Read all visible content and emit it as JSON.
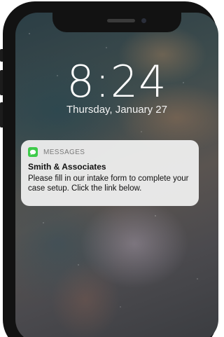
{
  "lock_screen": {
    "time": "8:24",
    "date": "Thursday, January 27"
  },
  "notification": {
    "app_name": "MESSAGES",
    "app_icon": "messages-icon",
    "title": "Smith & Associates",
    "body": "Please fill in our intake form to complete your case setup. Click the link below."
  },
  "colors": {
    "messages_icon_green": "#3ecb4a",
    "phone_frame": "#121212"
  }
}
